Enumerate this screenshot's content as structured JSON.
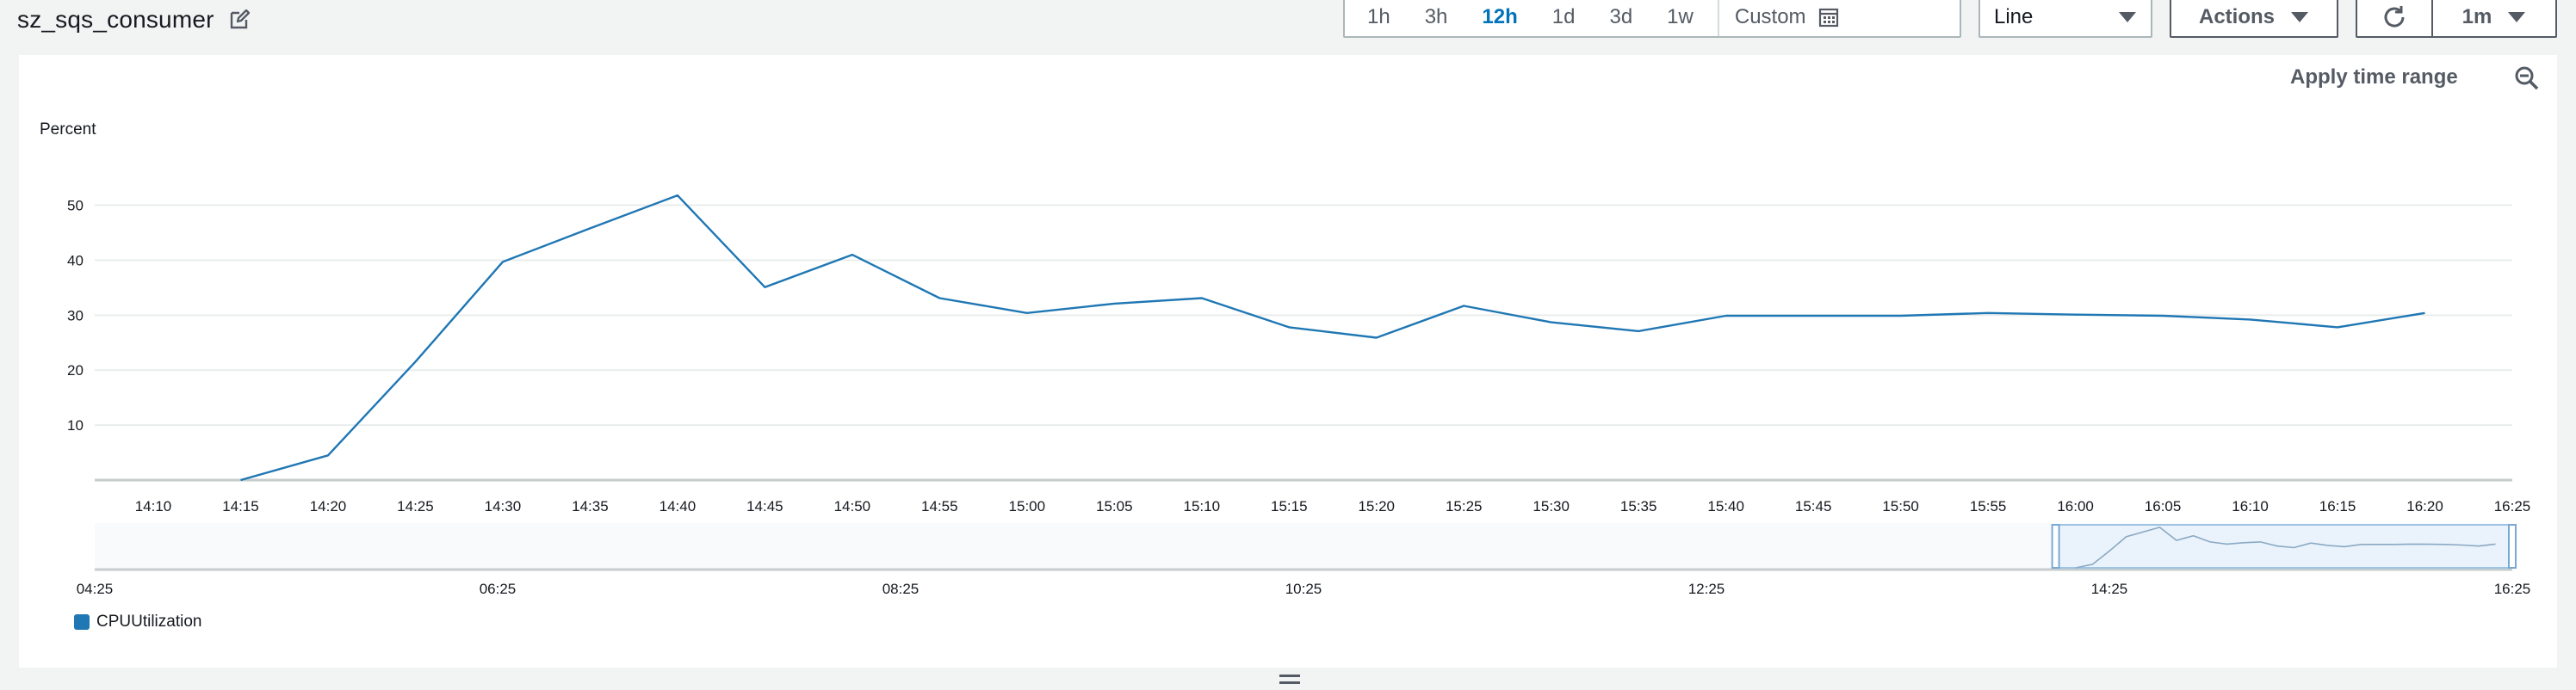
{
  "widget": {
    "title": "sz_sqs_consumer"
  },
  "time_range": {
    "options": [
      "1h",
      "3h",
      "12h",
      "1d",
      "3d",
      "1w"
    ],
    "active": "12h",
    "custom_label": "Custom"
  },
  "chart_type_select": {
    "value": "Line"
  },
  "actions": {
    "label": "Actions"
  },
  "refresh": {
    "interval": "1m"
  },
  "apply_time_range": {
    "label": "Apply time range"
  },
  "legend": {
    "label": "CPUUtilization",
    "color": "#1f77b4"
  },
  "icons": {
    "edit": "edit-icon",
    "calendar": "calendar-icon",
    "refresh": "refresh-icon",
    "zoom_out": "zoom-out-icon",
    "dropdown": "caret-down-icon",
    "resize": "resize-handle-icon"
  },
  "chart_data": {
    "type": "line",
    "ylabel": "Percent",
    "yticks": [
      10,
      20,
      30,
      40,
      50
    ],
    "ylim": [
      0,
      55
    ],
    "x_tick_labels": [
      "14:10",
      "14:15",
      "14:20",
      "14:25",
      "14:30",
      "14:35",
      "14:40",
      "14:45",
      "14:50",
      "14:55",
      "15:00",
      "15:05",
      "15:10",
      "15:15",
      "15:20",
      "15:25",
      "15:30",
      "15:35",
      "15:40",
      "15:45",
      "15:50",
      "15:55",
      "16:00",
      "16:05",
      "16:10",
      "16:15",
      "16:20",
      "16:25"
    ],
    "series": [
      {
        "name": "CPUUtilization",
        "color": "#1f77b4",
        "points": [
          [
            "14:15",
            0
          ],
          [
            "14:20",
            4.5
          ],
          [
            "14:25",
            21.5
          ],
          [
            "14:30",
            39.7
          ],
          [
            "14:35",
            45.8
          ],
          [
            "14:40",
            51.8
          ],
          [
            "14:45",
            35.1
          ],
          [
            "14:50",
            41.0
          ],
          [
            "14:55",
            33.1
          ],
          [
            "15:00",
            30.4
          ],
          [
            "15:05",
            32.1
          ],
          [
            "15:10",
            33.1
          ],
          [
            "15:15",
            27.8
          ],
          [
            "15:20",
            25.9
          ],
          [
            "15:25",
            31.7
          ],
          [
            "15:30",
            28.7
          ],
          [
            "15:35",
            27.1
          ],
          [
            "15:40",
            29.9
          ],
          [
            "15:45",
            29.9
          ],
          [
            "15:50",
            29.9
          ],
          [
            "15:55",
            30.4
          ],
          [
            "16:00",
            30.1
          ],
          [
            "16:05",
            29.9
          ],
          [
            "16:10",
            29.2
          ],
          [
            "16:15",
            27.8
          ],
          [
            "16:20",
            30.4
          ]
        ]
      }
    ],
    "overview": {
      "x_tick_labels": [
        "04:25",
        "06:25",
        "08:25",
        "10:25",
        "12:25",
        "14:25",
        "16:25"
      ],
      "selected_range": [
        "14:09",
        "16:25"
      ]
    },
    "grid": true,
    "legend_position": "bottom-left"
  }
}
